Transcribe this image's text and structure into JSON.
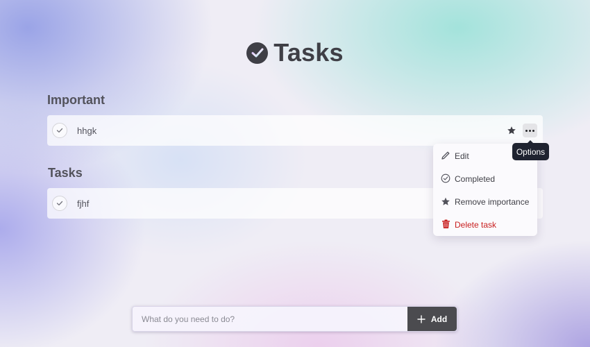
{
  "app": {
    "title": "Tasks"
  },
  "sections": {
    "important": {
      "title": "Important",
      "tasks": [
        {
          "text": "hhgk",
          "important": true
        }
      ]
    },
    "tasks": {
      "title": "Tasks",
      "tasks": [
        {
          "text": "fjhf",
          "important": false
        }
      ]
    }
  },
  "tooltip": {
    "label": "Options"
  },
  "context_menu": {
    "items": [
      {
        "label": "Edit",
        "icon": "pencil-icon"
      },
      {
        "label": "Completed",
        "icon": "check-circle-icon"
      },
      {
        "label": "Remove importance",
        "icon": "star-icon"
      },
      {
        "label": "Delete task",
        "icon": "trash-icon",
        "color": "#c81e1e"
      }
    ]
  },
  "add_bar": {
    "placeholder": "What do you need to do?",
    "button_label": "Add",
    "button_icon": "plus-icon"
  },
  "colors": {
    "accent_dark": "#3f3f46",
    "danger": "#c81e1e",
    "tooltip_bg": "#1f2330"
  }
}
